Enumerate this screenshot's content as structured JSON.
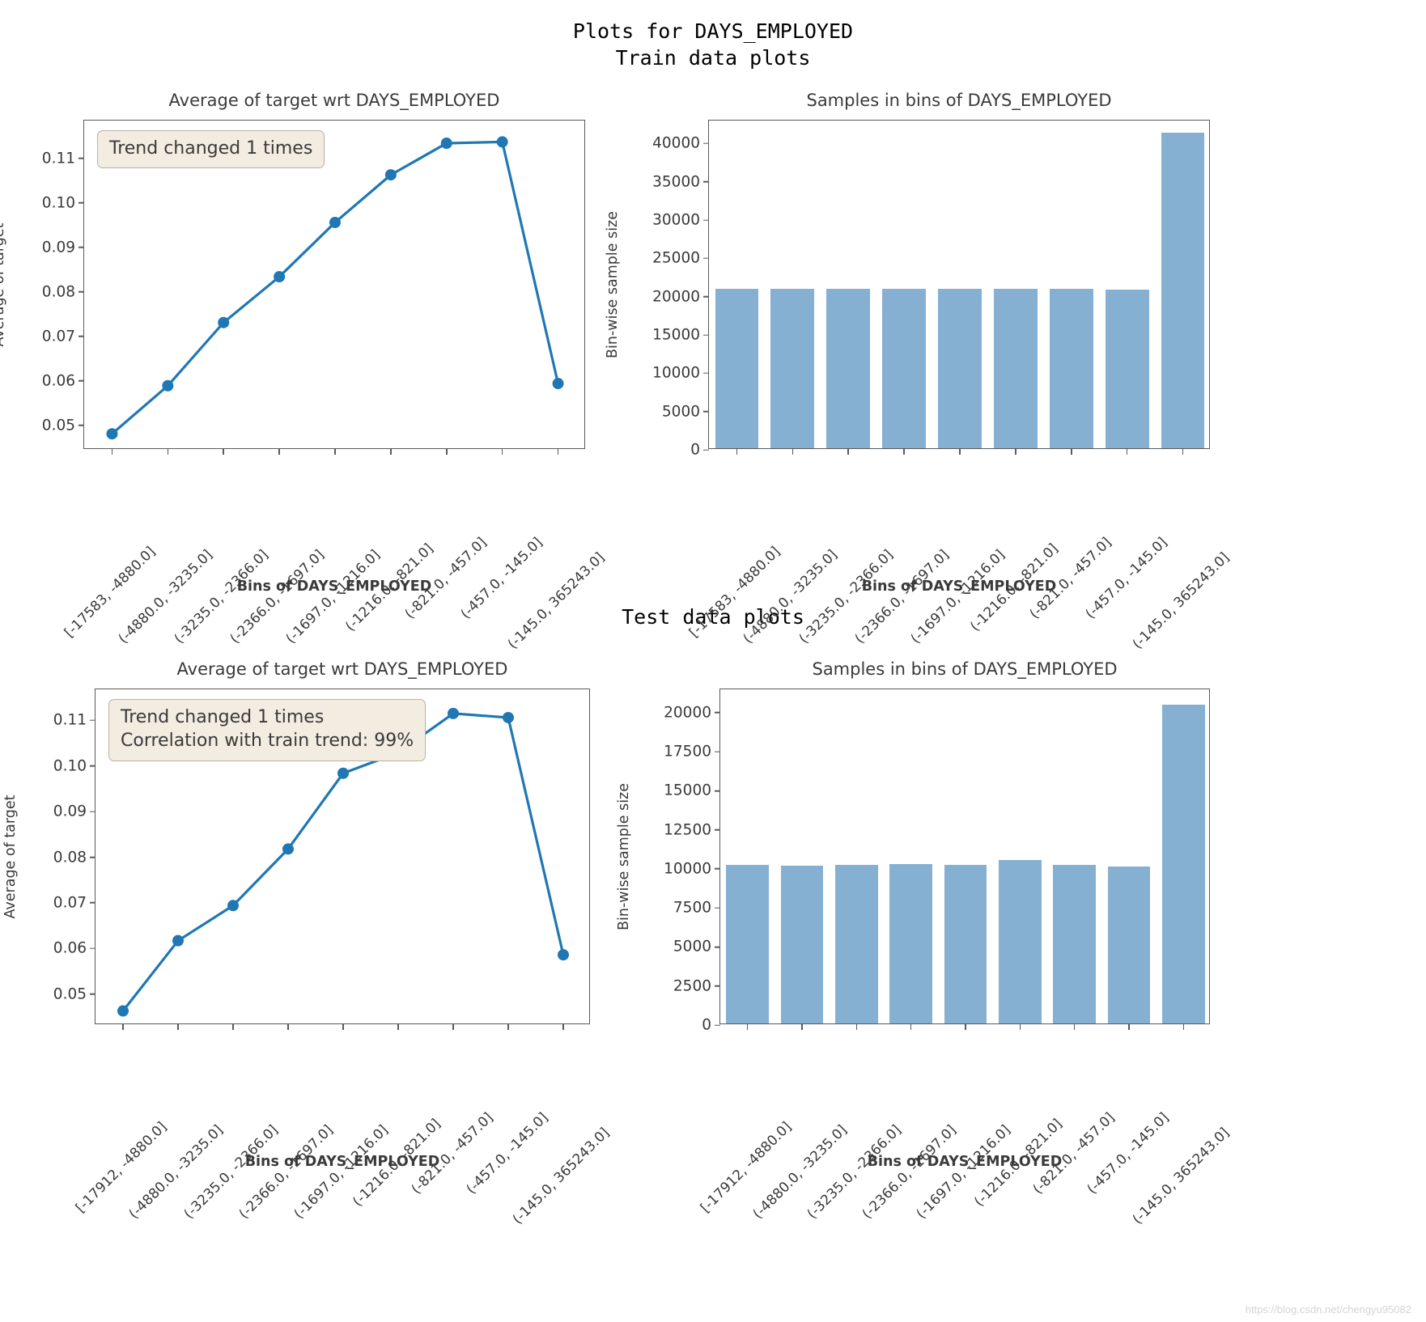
{
  "figure": {
    "suptitle_line1": "Plots for DAYS_EMPLOYED",
    "suptitle_line2": "Train data plots",
    "section_test_title": "Test data plots",
    "watermark": "https://blog.csdn.net/chengyu95082",
    "accent_line_color": "#1f77b4",
    "bar_color": "#86b0d2",
    "annotation_bg": "#f2ece1",
    "annotation_border": "#b9b2a4"
  },
  "chart_data": [
    {
      "id": "train-line",
      "type": "line",
      "title": "Average of target wrt DAYS_EMPLOYED",
      "xlabel": "Bins of DAYS_EMPLOYED",
      "ylabel": "Average of target",
      "grid": false,
      "legend": "none",
      "annotation": "Trend changed 1 times",
      "ylim": [
        0.0445,
        0.1185
      ],
      "yticks": [
        "0.05",
        "0.06",
        "0.07",
        "0.08",
        "0.09",
        "0.10",
        "0.11"
      ],
      "ytick_values": [
        0.05,
        0.06,
        0.07,
        0.08,
        0.09,
        0.1,
        0.11
      ],
      "categories": [
        "[-17583, -4880.0]",
        "(-4880.0, -3235.0]",
        "(-3235.0, -2366.0]",
        "(-2366.0, -1697.0]",
        "(-1697.0, -1216.0]",
        "(-1216.0, -821.0]",
        "(-821.0, -457.0]",
        "(-457.0, -145.0]",
        "(-145.0, 365243.0]"
      ],
      "values": [
        0.0481,
        0.0589,
        0.0731,
        0.0834,
        0.0956,
        0.1063,
        0.1134,
        0.1137,
        0.0594
      ]
    },
    {
      "id": "train-bars",
      "type": "bar",
      "title": "Samples in bins of DAYS_EMPLOYED",
      "xlabel": "Bins of DAYS_EMPLOYED",
      "ylabel": "Bin-wise sample size",
      "grid": false,
      "legend": "none",
      "ylim": [
        0,
        43000
      ],
      "yticks": [
        "0",
        "5000",
        "10000",
        "15000",
        "20000",
        "25000",
        "30000",
        "35000",
        "40000"
      ],
      "ytick_values": [
        0,
        5000,
        10000,
        15000,
        20000,
        25000,
        30000,
        35000,
        40000
      ],
      "categories": [
        "[-17583, -4880.0]",
        "(-4880.0, -3235.0]",
        "(-3235.0, -2366.0]",
        "(-2366.0, -1697.0]",
        "(-1697.0, -1216.0]",
        "(-1216.0, -821.0]",
        "(-821.0, -457.0]",
        "(-457.0, -145.0]",
        "(-145.0, 365243.0]"
      ],
      "values": [
        20800,
        20800,
        20800,
        20800,
        20800,
        20800,
        20800,
        20750,
        41200
      ]
    },
    {
      "id": "test-line",
      "type": "line",
      "title": "Average of target wrt DAYS_EMPLOYED",
      "xlabel": "Bins of DAYS_EMPLOYED",
      "ylabel": "Average of target",
      "grid": false,
      "legend": "none",
      "annotation": "Trend changed 1 times\nCorrelation with train trend: 99%",
      "ylim": [
        0.0432,
        0.1168
      ],
      "yticks": [
        "0.05",
        "0.06",
        "0.07",
        "0.08",
        "0.09",
        "0.10",
        "0.11"
      ],
      "ytick_values": [
        0.05,
        0.06,
        0.07,
        0.08,
        0.09,
        0.1,
        0.11
      ],
      "categories": [
        "[-17912, -4880.0]",
        "(-4880.0, -3235.0]",
        "(-3235.0, -2366.0]",
        "(-2366.0, -1697.0]",
        "(-1697.0, -1216.0]",
        "(-1216.0, -821.0]",
        "(-821.0, -457.0]",
        "(-457.0, -145.0]",
        "(-145.0, 365243.0]"
      ],
      "values": [
        0.0463,
        0.0617,
        0.0694,
        0.0818,
        0.0984,
        0.1029,
        0.1115,
        0.1106,
        0.0586
      ]
    },
    {
      "id": "test-bars",
      "type": "bar",
      "title": "Samples in bins of DAYS_EMPLOYED",
      "xlabel": "Bins of DAYS_EMPLOYED",
      "ylabel": "Bin-wise sample size",
      "grid": false,
      "legend": "none",
      "ylim": [
        0,
        21500
      ],
      "yticks": [
        "0",
        "2500",
        "5000",
        "7500",
        "10000",
        "12500",
        "15000",
        "17500",
        "20000"
      ],
      "ytick_values": [
        0,
        2500,
        5000,
        7500,
        10000,
        12500,
        15000,
        17500,
        20000
      ],
      "categories": [
        "[-17912, -4880.0]",
        "(-4880.0, -3235.0]",
        "(-3235.0, -2366.0]",
        "(-2366.0, -1697.0]",
        "(-1697.0, -1216.0]",
        "(-1216.0, -821.0]",
        "(-821.0, -457.0]",
        "(-457.0, -145.0]",
        "(-145.0, 365243.0]"
      ],
      "values": [
        10150,
        10100,
        10180,
        10190,
        10170,
        10450,
        10150,
        10030,
        20400
      ]
    }
  ]
}
